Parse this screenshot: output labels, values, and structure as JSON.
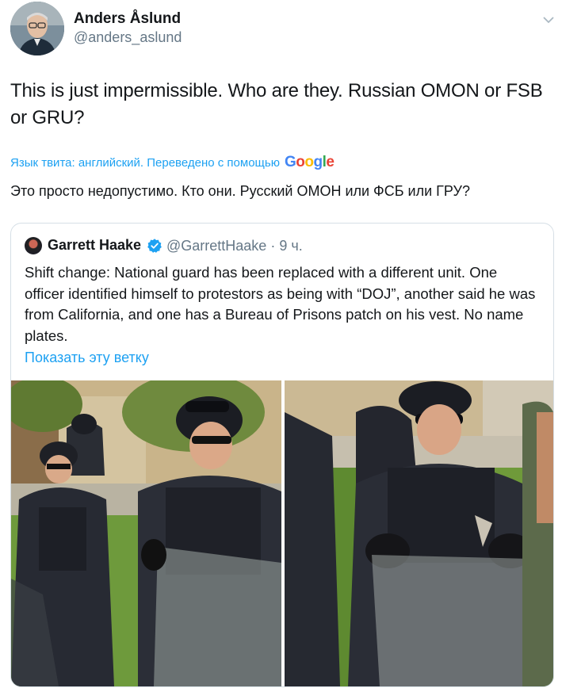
{
  "author": {
    "display_name": "Anders Åslund",
    "handle": "@anders_aslund"
  },
  "tweet": {
    "text": "This is just impermissible. Who are they. Russian OMON or FSB or GRU?",
    "translation_label": "Язык твита: английский. Переведено с помощью",
    "translation_provider": [
      "G",
      "o",
      "o",
      "g",
      "l",
      "e"
    ],
    "translated_text": "Это просто недопустимо. Кто они. Русский ОМОН или ФСБ или ГРУ?"
  },
  "quoted": {
    "display_name": "Garrett Haake",
    "handle_time": "@GarrettHaake · 9 ч.",
    "text": "Shift change: National guard has been replaced with a different unit. One officer identified himself to protestors as being with “DOJ”, another said he was from California, and one has a Bureau of Prisons patch on his vest. No name plates.",
    "show_thread_label": "Показать эту ветку"
  },
  "colors": {
    "link": "#1da1f2",
    "secondary_text": "#657786",
    "verified": "#1da1f2"
  },
  "icons": {
    "menu": "chevron-down-icon",
    "verified": "verified-badge-icon"
  }
}
